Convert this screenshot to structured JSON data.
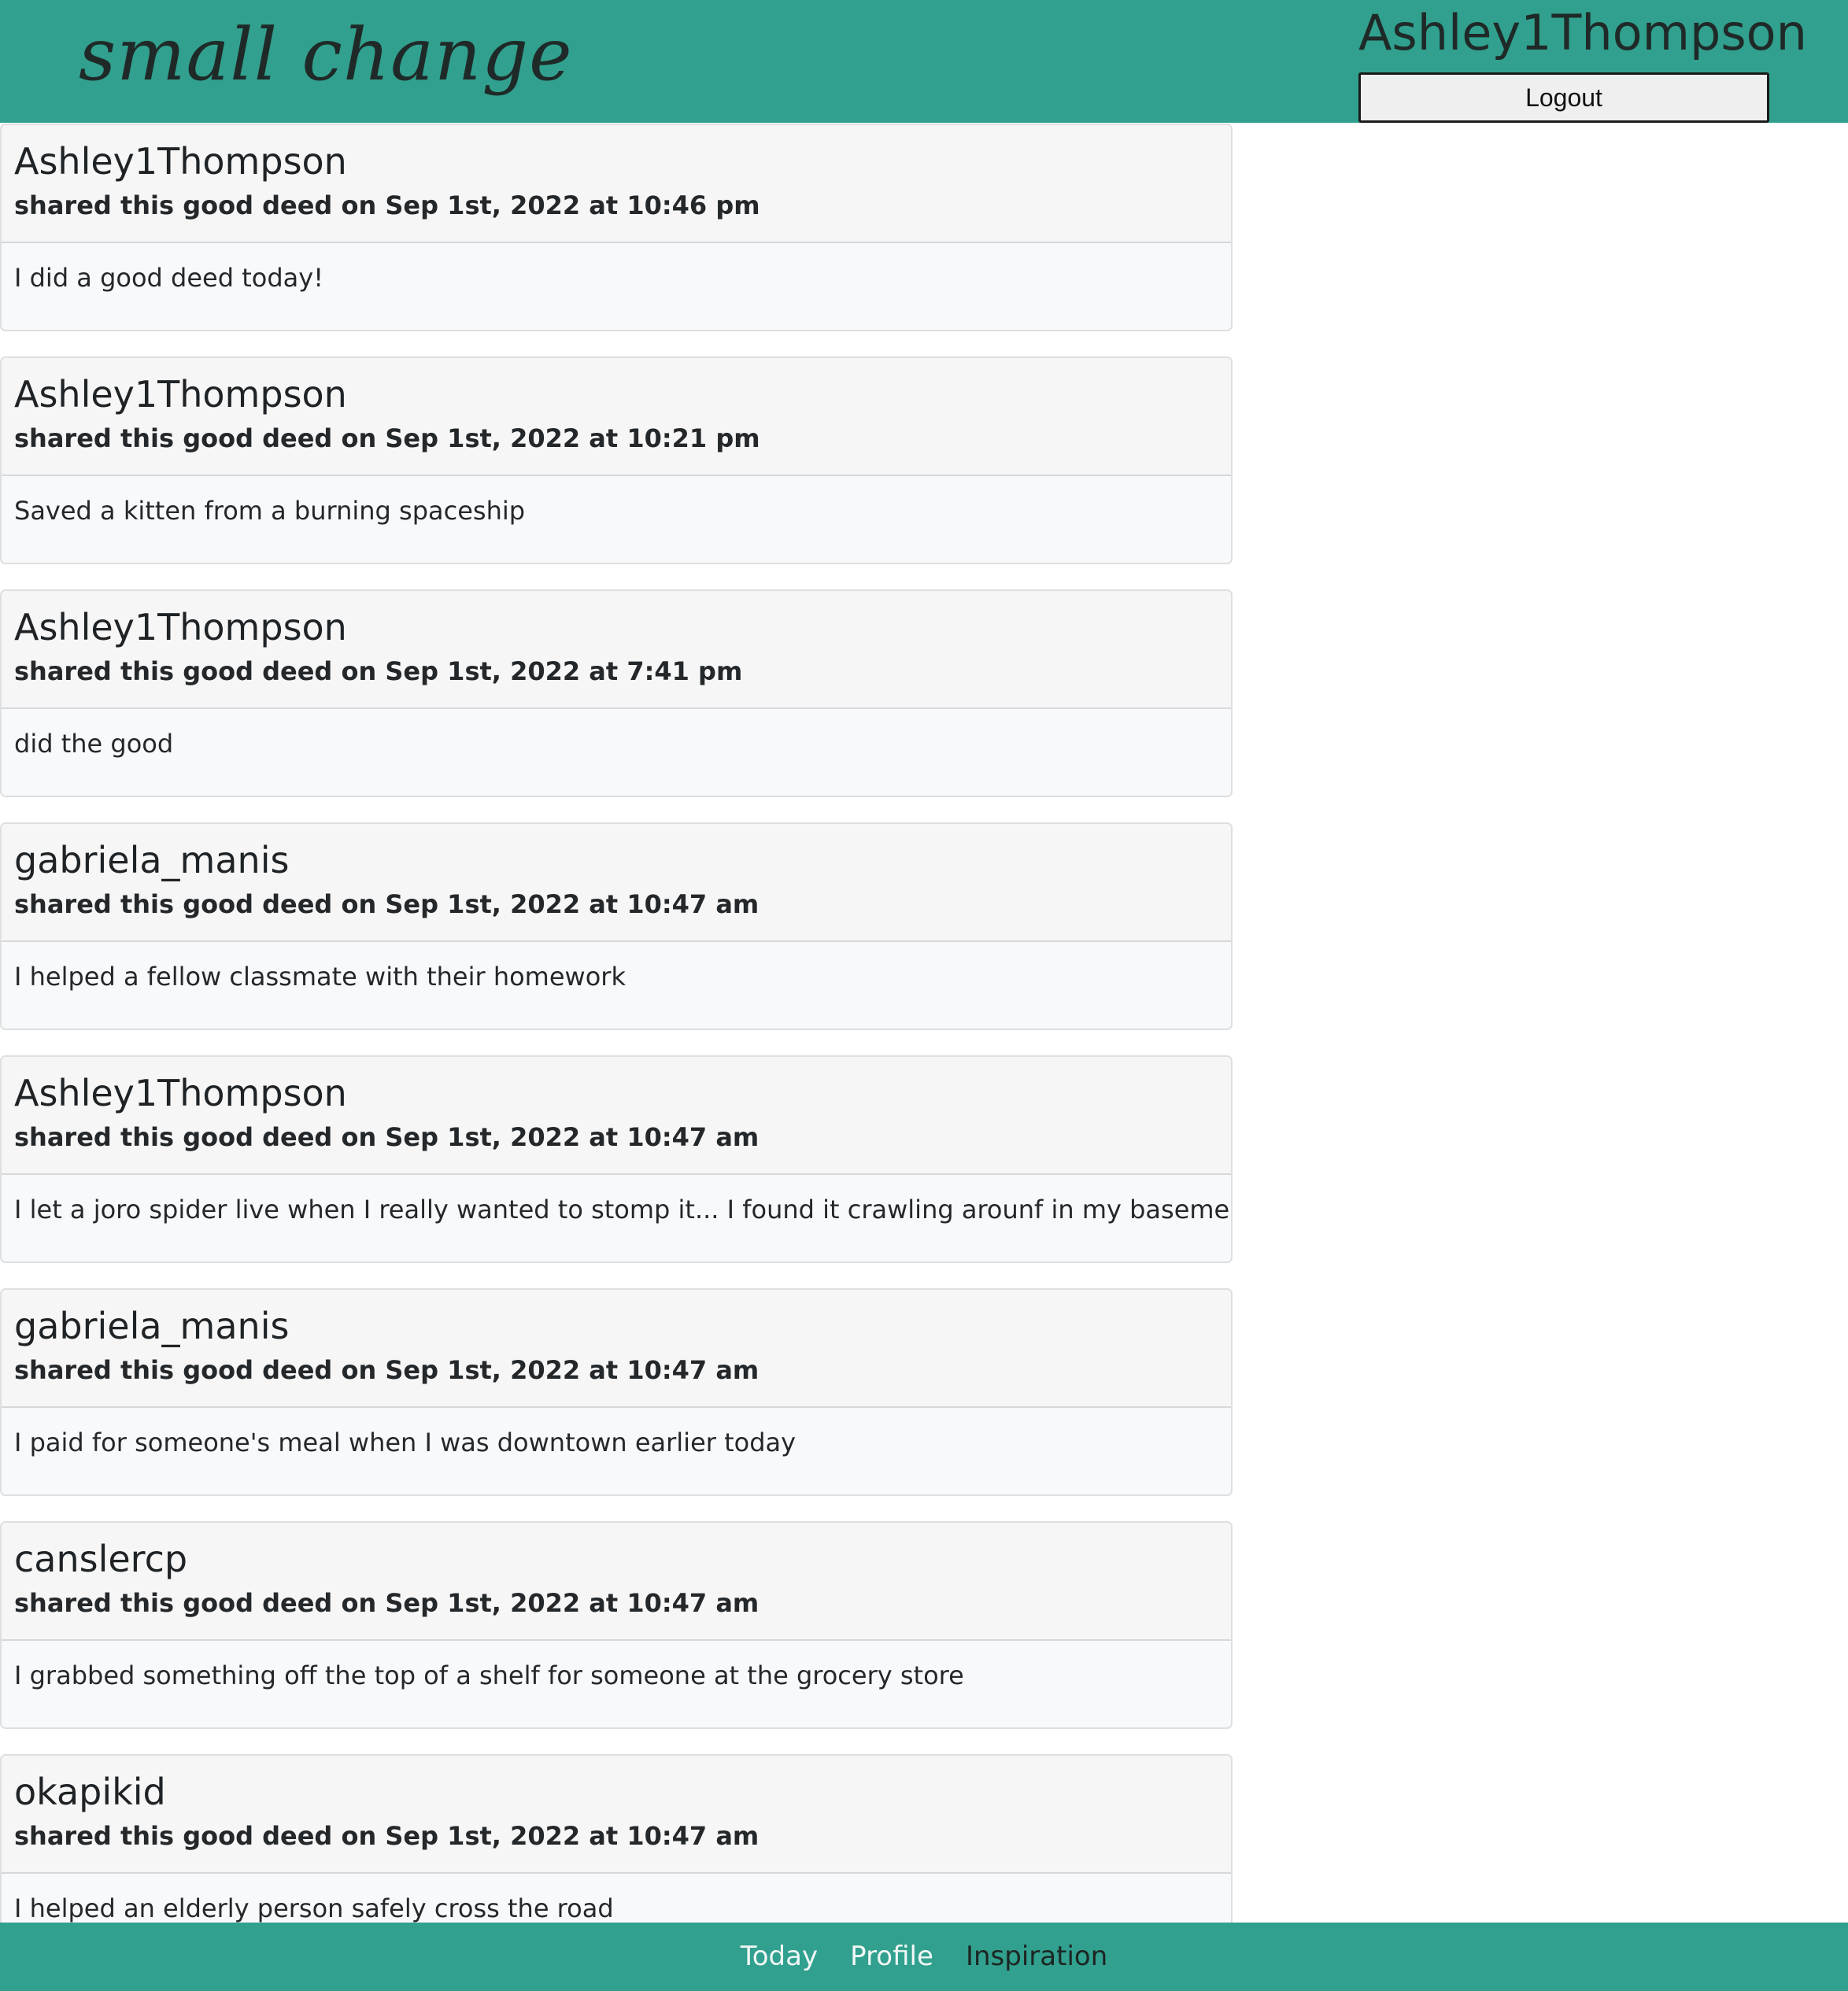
{
  "header": {
    "brand": "small change",
    "username": "Ashley1Thompson",
    "logout_label": "Logout"
  },
  "feed": [
    {
      "user": "Ashley1Thompson",
      "meta": "shared this good deed on Sep 1st, 2022 at 10:46 pm",
      "text": "I did a good deed today!"
    },
    {
      "user": "Ashley1Thompson",
      "meta": "shared this good deed on Sep 1st, 2022 at 10:21 pm",
      "text": "Saved a kitten from a burning spaceship"
    },
    {
      "user": "Ashley1Thompson",
      "meta": "shared this good deed on Sep 1st, 2022 at 7:41 pm",
      "text": "did the good"
    },
    {
      "user": "gabriela_manis",
      "meta": "shared this good deed on Sep 1st, 2022 at 10:47 am",
      "text": "I helped a fellow classmate with their homework"
    },
    {
      "user": "Ashley1Thompson",
      "meta": "shared this good deed on Sep 1st, 2022 at 10:47 am",
      "text": "I let a joro spider live when I really wanted to stomp it... I found it crawling arounf in my basement o_o"
    },
    {
      "user": "gabriela_manis",
      "meta": "shared this good deed on Sep 1st, 2022 at 10:47 am",
      "text": "I paid for someone's meal when I was downtown earlier today"
    },
    {
      "user": "canslercp",
      "meta": "shared this good deed on Sep 1st, 2022 at 10:47 am",
      "text": "I grabbed something off the top of a shelf for someone at the grocery store"
    },
    {
      "user": "okapikid",
      "meta": "shared this good deed on Sep 1st, 2022 at 10:47 am",
      "text": "I helped an elderly person safely cross the road"
    }
  ],
  "footer": {
    "links": [
      "Today",
      "Profile",
      "Inspiration"
    ]
  },
  "colors": {
    "accent": "#31a08e",
    "card_background": "#f8f9fa",
    "card_border": "#dddfe1"
  }
}
